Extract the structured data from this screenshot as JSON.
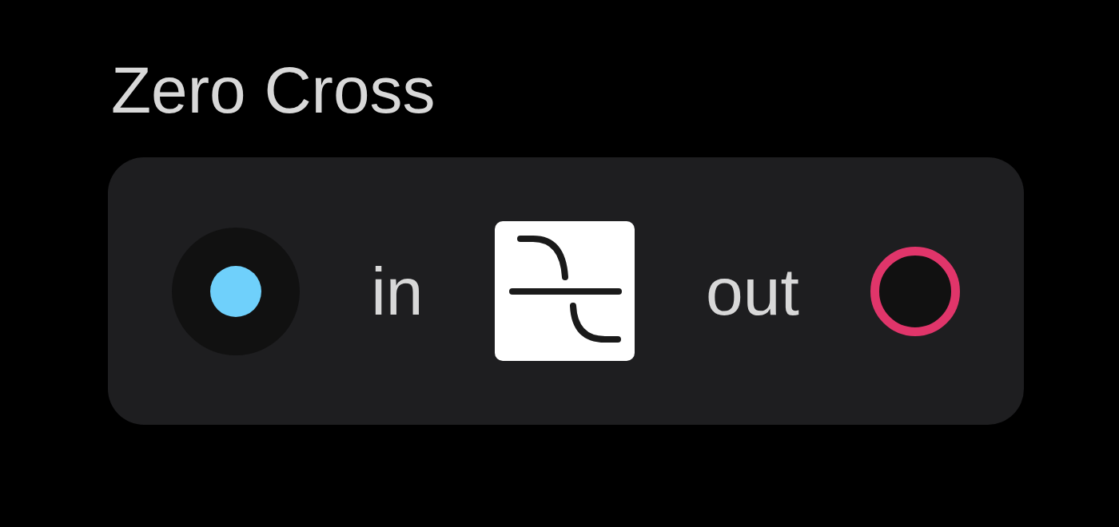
{
  "node": {
    "title": "Zero Cross",
    "ports": [
      {
        "kind": "input",
        "label": "in",
        "color": "#6fd0fb"
      },
      {
        "kind": "output",
        "label": "out",
        "color": "#e0356a"
      }
    ]
  }
}
